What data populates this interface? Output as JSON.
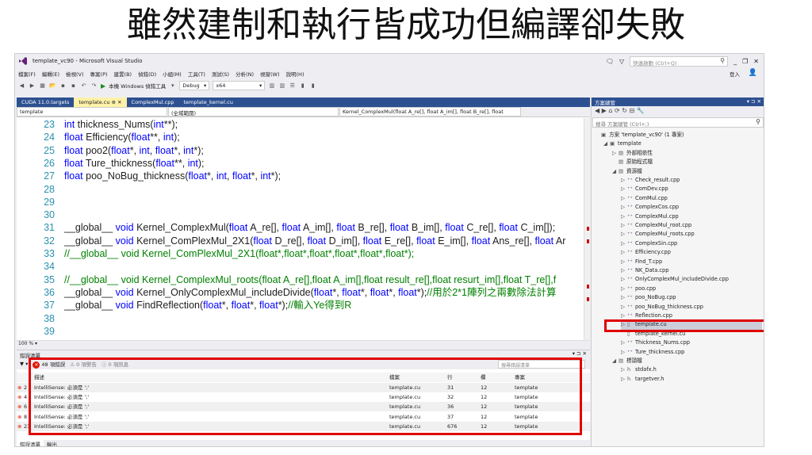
{
  "slide_title": "雖然建制和執行皆成功但編譯卻失敗",
  "window": {
    "title": "template_vc90 - Microsoft Visual Studio",
    "quick_launch_placeholder": "快速啟動 (Ctrl+Q)",
    "signin": "登入"
  },
  "menu": [
    "檔案(F)",
    "編輯(E)",
    "檢視(V)",
    "專案(P)",
    "建置(B)",
    "偵錯(D)",
    "小組(M)",
    "工具(T)",
    "測試(S)",
    "分析(N)",
    "視窗(W)",
    "說明(H)"
  ],
  "toolbar": {
    "run_label": "本機 Windows 偵錯工具",
    "config": "Debug",
    "platform": "x64"
  },
  "doc_tabs": [
    {
      "label": "CUDA 11.0.targets",
      "active": false
    },
    {
      "label": "template.cu  ⊕  ✕",
      "active": true
    },
    {
      "label": "ComplexMul.cpp",
      "active": false
    },
    {
      "label": "template_kernel.cu",
      "active": false
    }
  ],
  "nav": {
    "project": "template",
    "scope": "(全域範圍)",
    "member": "Kernel_ComplexMul(float A_re[], float A_im[], float B_re[], float"
  },
  "code_lines": [
    {
      "n": "23",
      "text": "int thickness_Nums(int**);"
    },
    {
      "n": "24",
      "text": "float Efficiency(float**, int);"
    },
    {
      "n": "25",
      "text": "float poo2(float*, int, float*, int*);"
    },
    {
      "n": "26",
      "text": "float Ture_thickness(float**, int);"
    },
    {
      "n": "27",
      "text": "float poo_NoBug_thickness(float*, int, float*, int*);"
    },
    {
      "n": "28",
      "text": ""
    },
    {
      "n": "29",
      "text": ""
    },
    {
      "n": "30",
      "text": ""
    },
    {
      "n": "31",
      "text": "__global__ void Kernel_ComplexMul(float A_re[], float A_im[], float B_re[], float B_im[], float C_re[], float C_im[]);"
    },
    {
      "n": "32",
      "text": "__global__ void Kernel_ComPlexMul_2X1(float D_re[], float D_im[], float E_re[], float E_im[], float Ans_re[], float Ar"
    },
    {
      "n": "33",
      "text": "//__global__ void Kernel_ComPlexMul_2X1(float*,float*,float*,float*,float*,float*);"
    },
    {
      "n": "34",
      "text": ""
    },
    {
      "n": "35",
      "text": "//__global__ void Kernel_ComplexMul_roots(float A_re[],float A_im[],float result_re[],float resurt_im[],float T_re[],f"
    },
    {
      "n": "36",
      "text": "__global__ void Kernel_OnlyComplexMul_includeDivide(float*, float*, float*, float*);//用於2*1陣列之兩數除法計算"
    },
    {
      "n": "37",
      "text": "__global__ void FindReflection(float*, float*, float*);//輸入Ye得到R"
    },
    {
      "n": "38",
      "text": ""
    },
    {
      "n": "39",
      "text": ""
    }
  ],
  "zoom": "100 %",
  "error_list": {
    "title": "錯誤清單",
    "errors_label": "48 項錯誤",
    "warnings_label": "0 項警告",
    "messages_label": "0 項訊息",
    "search_placeholder": "搜尋錯誤清單",
    "columns": [
      "描述",
      "檔案",
      "行",
      "欄",
      "專案"
    ],
    "rows": [
      {
        "id": "2",
        "desc": "IntelliSense: 必須是 ';'",
        "file": "template.cu",
        "line": "31",
        "col": "12",
        "project": "template"
      },
      {
        "id": "4",
        "desc": "IntelliSense: 必須是 ';'",
        "file": "template.cu",
        "line": "32",
        "col": "12",
        "project": "template"
      },
      {
        "id": "6",
        "desc": "IntelliSense: 必須是 ';'",
        "file": "template.cu",
        "line": "36",
        "col": "12",
        "project": "template"
      },
      {
        "id": "8",
        "desc": "IntelliSense: 必須是 ';'",
        "file": "template.cu",
        "line": "37",
        "col": "12",
        "project": "template"
      },
      {
        "id": "23",
        "desc": "IntelliSense: 必須是 ';'",
        "file": "template.cu",
        "line": "676",
        "col": "12",
        "project": "template"
      }
    ],
    "bottom_tabs": [
      "錯誤清單",
      "輸出"
    ]
  },
  "solution_explorer": {
    "title": "方案總管",
    "search_placeholder": "搜尋 方案總管 (Ctrl+;)",
    "items": [
      {
        "label": "方案 'template_vc90' (1 專案)",
        "level": 0,
        "arrow": "",
        "icon": "▣"
      },
      {
        "label": "template",
        "level": 1,
        "arrow": "◢",
        "icon": "▣"
      },
      {
        "label": "外部相依性",
        "level": 2,
        "arrow": "▷",
        "icon": "▤"
      },
      {
        "label": "原始程式檔",
        "level": 2,
        "arrow": "",
        "icon": "▤"
      },
      {
        "label": "資源檔",
        "level": 2,
        "arrow": "◢",
        "icon": "▤"
      },
      {
        "label": "Check_result.cpp",
        "level": 3,
        "arrow": "▷",
        "icon": "⁺⁺"
      },
      {
        "label": "ComDev.cpp",
        "level": 3,
        "arrow": "▷",
        "icon": "⁺⁺"
      },
      {
        "label": "ComMul.cpp",
        "level": 3,
        "arrow": "▷",
        "icon": "⁺⁺"
      },
      {
        "label": "ComplexCos.cpp",
        "level": 3,
        "arrow": "▷",
        "icon": "⁺⁺"
      },
      {
        "label": "ComplexMul.cpp",
        "level": 3,
        "arrow": "▷",
        "icon": "⁺⁺"
      },
      {
        "label": "ComplexMul_root.cpp",
        "level": 3,
        "arrow": "▷",
        "icon": "⁺⁺"
      },
      {
        "label": "ComplexMul_roots.cpp",
        "level": 3,
        "arrow": "▷",
        "icon": "⁺⁺"
      },
      {
        "label": "ComplexSin.cpp",
        "level": 3,
        "arrow": "▷",
        "icon": "⁺⁺"
      },
      {
        "label": "Efficiency.cpp",
        "level": 3,
        "arrow": "▷",
        "icon": "⁺⁺"
      },
      {
        "label": "Find_T.cpp",
        "level": 3,
        "arrow": "▷",
        "icon": "⁺⁺"
      },
      {
        "label": "NK_Data.cpp",
        "level": 3,
        "arrow": "▷",
        "icon": "⁺⁺"
      },
      {
        "label": "OnlyComplexMul_includeDivide.cpp",
        "level": 3,
        "arrow": "▷",
        "icon": "⁺⁺"
      },
      {
        "label": "poo.cpp",
        "level": 3,
        "arrow": "▷",
        "icon": "⁺⁺"
      },
      {
        "label": "poo_NoBug.cpp",
        "level": 3,
        "arrow": "▷",
        "icon": "⁺⁺"
      },
      {
        "label": "poo_NoBug_thickness.cpp",
        "level": 3,
        "arrow": "▷",
        "icon": "⁺⁺"
      },
      {
        "label": "Reflection.cpp",
        "level": 3,
        "arrow": "▷",
        "icon": "⁺⁺"
      },
      {
        "label": "template.cu",
        "level": 3,
        "arrow": "▷",
        "icon": "▯"
      },
      {
        "label": "template_kernel.cu",
        "level": 3,
        "arrow": "",
        "icon": "▯"
      },
      {
        "label": "Thickness_Nums.cpp",
        "level": 3,
        "arrow": "▷",
        "icon": "⁺⁺"
      },
      {
        "label": "Ture_thickness.cpp",
        "level": 3,
        "arrow": "▷",
        "icon": "⁺⁺"
      },
      {
        "label": "標頭檔",
        "level": 2,
        "arrow": "◢",
        "icon": "▤"
      },
      {
        "label": "stdafx.h",
        "level": 3,
        "arrow": "▷",
        "icon": "h"
      },
      {
        "label": "targetver.h",
        "level": 3,
        "arrow": "▷",
        "icon": "h"
      }
    ],
    "selected_index": 21
  },
  "colors": {
    "keyword": "#0000ff",
    "comment": "#008000",
    "line_number": "#2b91af",
    "highlight_box": "#e00000",
    "tab_bar": "#2d5091"
  }
}
